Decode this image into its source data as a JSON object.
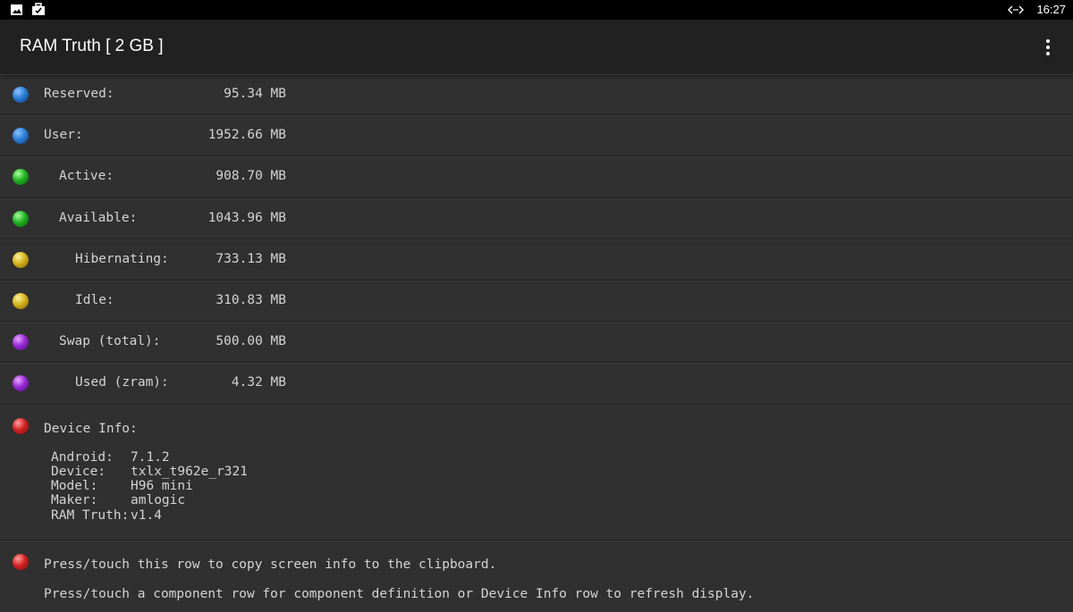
{
  "status_bar": {
    "time": "16:27",
    "icons": [
      "gallery-icon",
      "briefcase-icon",
      "code-arrows-icon"
    ]
  },
  "app_bar": {
    "title": "RAM Truth   [ 2 GB ]",
    "menu_icon": "overflow-menu-icon"
  },
  "memory_rows": [
    {
      "color": "blue",
      "label": "Reserved:",
      "value": "95.34 MB",
      "indent": 0
    },
    {
      "color": "blue",
      "label": "User:",
      "value": "1952.66 MB",
      "indent": 0
    },
    {
      "color": "green",
      "label": "Active:",
      "value": "908.70 MB",
      "indent": 1
    },
    {
      "color": "green",
      "label": "Available:",
      "value": "1043.96 MB",
      "indent": 1
    },
    {
      "color": "yellow",
      "label": "Hibernating:",
      "value": "733.13 MB",
      "indent": 2
    },
    {
      "color": "yellow",
      "label": "Idle:",
      "value": "310.83 MB",
      "indent": 2
    },
    {
      "color": "purple",
      "label": "Swap (total):",
      "value": "500.00 MB",
      "indent": 1
    },
    {
      "color": "purple",
      "label": "Used (zram):",
      "value": "4.32 MB",
      "indent": 2
    }
  ],
  "device_info": {
    "title": "Device Info:",
    "fields": [
      {
        "key": "Android:",
        "value": "7.1.2"
      },
      {
        "key": "Device:",
        "value": "txlx_t962e_r321"
      },
      {
        "key": "Model:",
        "value": "H96 mini"
      },
      {
        "key": "Maker:",
        "value": "amlogic"
      },
      {
        "key": "RAM Truth:",
        "value": "v1.4"
      }
    ]
  },
  "copy_row": {
    "line1": "Press/touch this row to copy screen info to the clipboard.",
    "line2": "Press/touch a component row for component definition or Device Info row to refresh display."
  }
}
